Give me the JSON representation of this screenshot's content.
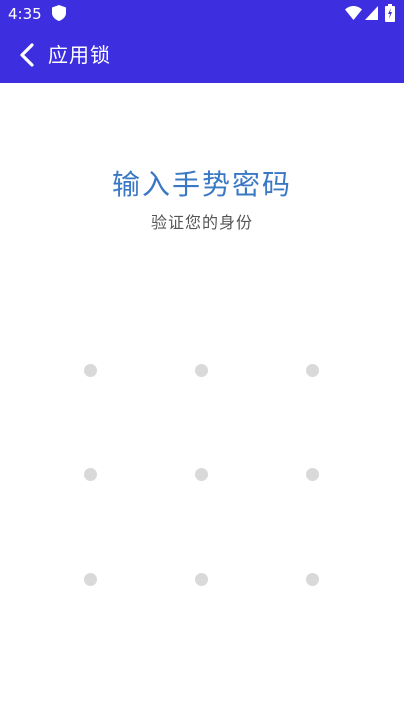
{
  "status_bar": {
    "time": "4:35",
    "icons": [
      "shield-icon",
      "wifi-icon",
      "signal-icon",
      "battery-icon"
    ]
  },
  "app_bar": {
    "back_icon": "chevron-left-icon",
    "title": "应用锁"
  },
  "prompt": {
    "title": "输入手势密码",
    "subtitle": "验证您的身份"
  },
  "pattern": {
    "rows": 3,
    "cols": 3
  },
  "colors": {
    "primary": "#3d2fe0",
    "title_text": "#3b78c4",
    "subtitle_text": "#555555",
    "dot": "#d9d9d9",
    "background": "#ffffff"
  }
}
